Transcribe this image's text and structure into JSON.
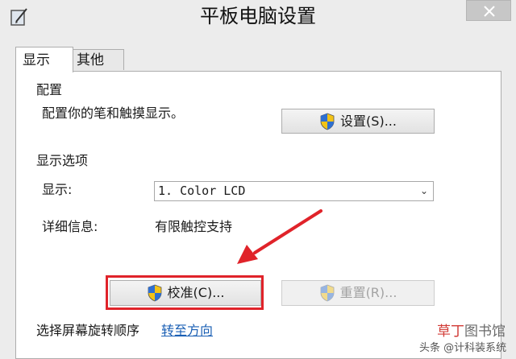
{
  "window": {
    "title": "平板电脑设置",
    "app_icon": "tablet-pen-icon",
    "close_icon": "close-icon"
  },
  "tabs": [
    {
      "label": "显示",
      "selected": true
    },
    {
      "label": "其他",
      "selected": false
    }
  ],
  "config_group": {
    "legend": "配置",
    "description": "配置你的笔和触摸显示。",
    "button_label": "设置(S)...",
    "button_icon": "uac-shield-icon"
  },
  "display_group": {
    "legend": "显示选项",
    "display_label": "显示:",
    "display_value": "1. Color LCD",
    "details_label": "详细信息:",
    "details_value": "有限触控支持",
    "calibrate_label": "校准(C)...",
    "reset_label": "重置(R)...",
    "reset_enabled": false
  },
  "rotation": {
    "text": "选择屏幕旋转顺序",
    "link": "转至方向"
  },
  "annotation": {
    "color": "#e0232a",
    "highlighted": "calibrate-button"
  },
  "watermark": {
    "line1_red": "草丁",
    "line1_rest": "图书馆",
    "line2": "头条 @计科装系统"
  }
}
